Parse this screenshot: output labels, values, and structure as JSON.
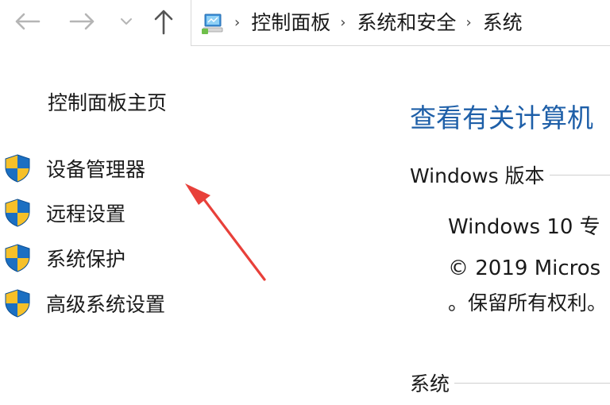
{
  "navigation": {
    "back_icon": "arrow-left-icon",
    "forward_icon": "arrow-right-icon",
    "recent_icon": "chevron-down-icon",
    "up_icon": "arrow-up-icon"
  },
  "address_bar": {
    "location_icon": "control-panel-computer-icon",
    "separator": "›",
    "breadcrumbs": [
      "控制面板",
      "系统和安全",
      "系统"
    ]
  },
  "sidebar": {
    "home_link": "控制面板主页",
    "tasks": [
      {
        "label": "设备管理器",
        "icon": "uac-shield-icon"
      },
      {
        "label": "远程设置",
        "icon": "uac-shield-icon"
      },
      {
        "label": "系统保护",
        "icon": "uac-shield-icon"
      },
      {
        "label": "高级系统设置",
        "icon": "uac-shield-icon"
      }
    ]
  },
  "main": {
    "heading": "查看有关计算机",
    "edition_section": {
      "header": "Windows 版本",
      "edition": "Windows 10 专",
      "copyright_line1": "© 2019 Micros",
      "copyright_line2": "。保留所有权利。"
    },
    "system_section": {
      "header": "系统"
    }
  },
  "annotation": {
    "type": "red-arrow",
    "color": "#e8403a",
    "target": "设备管理器"
  },
  "colors": {
    "heading_blue": "#1e5fa8",
    "shield_blue": "#1b6fc2",
    "shield_yellow": "#f6c028",
    "arrow_red": "#e8403a"
  }
}
